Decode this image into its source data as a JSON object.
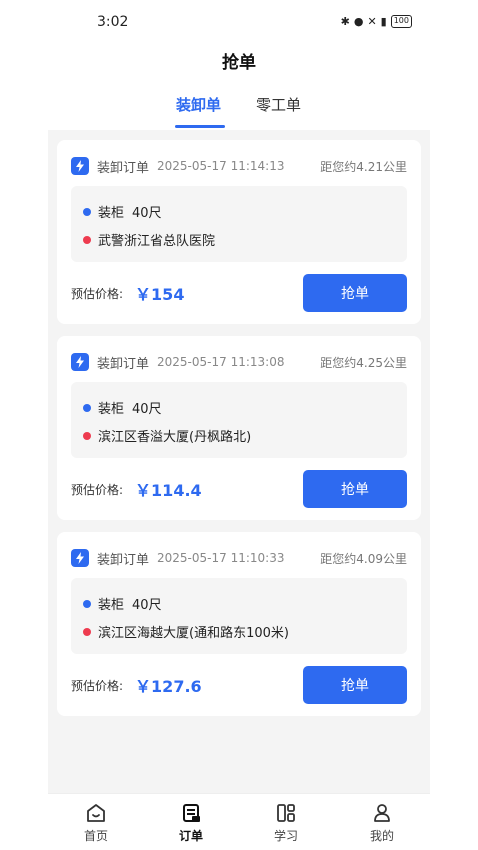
{
  "status_bar": {
    "time": "3:02",
    "battery": "100"
  },
  "header": {
    "title": "抢单"
  },
  "tabs": [
    {
      "label": "装卸单",
      "active": true
    },
    {
      "label": "零工单",
      "active": false
    }
  ],
  "orders": [
    {
      "type": "装卸订单",
      "time": "2025-05-17 11:14:13",
      "distance": "距您约4.21公里",
      "cargo": "装柜",
      "size": "40尺",
      "address": "武警浙江省总队医院",
      "price_label": "预估价格:",
      "price": "￥154",
      "button": "抢单"
    },
    {
      "type": "装卸订单",
      "time": "2025-05-17 11:13:08",
      "distance": "距您约4.25公里",
      "cargo": "装柜",
      "size": "40尺",
      "address": "滨江区香溢大厦(丹枫路北)",
      "price_label": "预估价格:",
      "price": "￥114.4",
      "button": "抢单"
    },
    {
      "type": "装卸订单",
      "time": "2025-05-17 11:10:33",
      "distance": "距您约4.09公里",
      "cargo": "装柜",
      "size": "40尺",
      "address": "滨江区海越大厦(通和路东100米)",
      "price_label": "预估价格:",
      "price": "￥127.6",
      "button": "抢单"
    }
  ],
  "bottom_nav": [
    {
      "label": "首页",
      "icon": "home-icon"
    },
    {
      "label": "订单",
      "icon": "order-icon",
      "active": true
    },
    {
      "label": "学习",
      "icon": "study-icon"
    },
    {
      "label": "我的",
      "icon": "profile-icon"
    }
  ],
  "colors": {
    "accent": "#2e6af0",
    "red_dot": "#ee3b4f"
  }
}
